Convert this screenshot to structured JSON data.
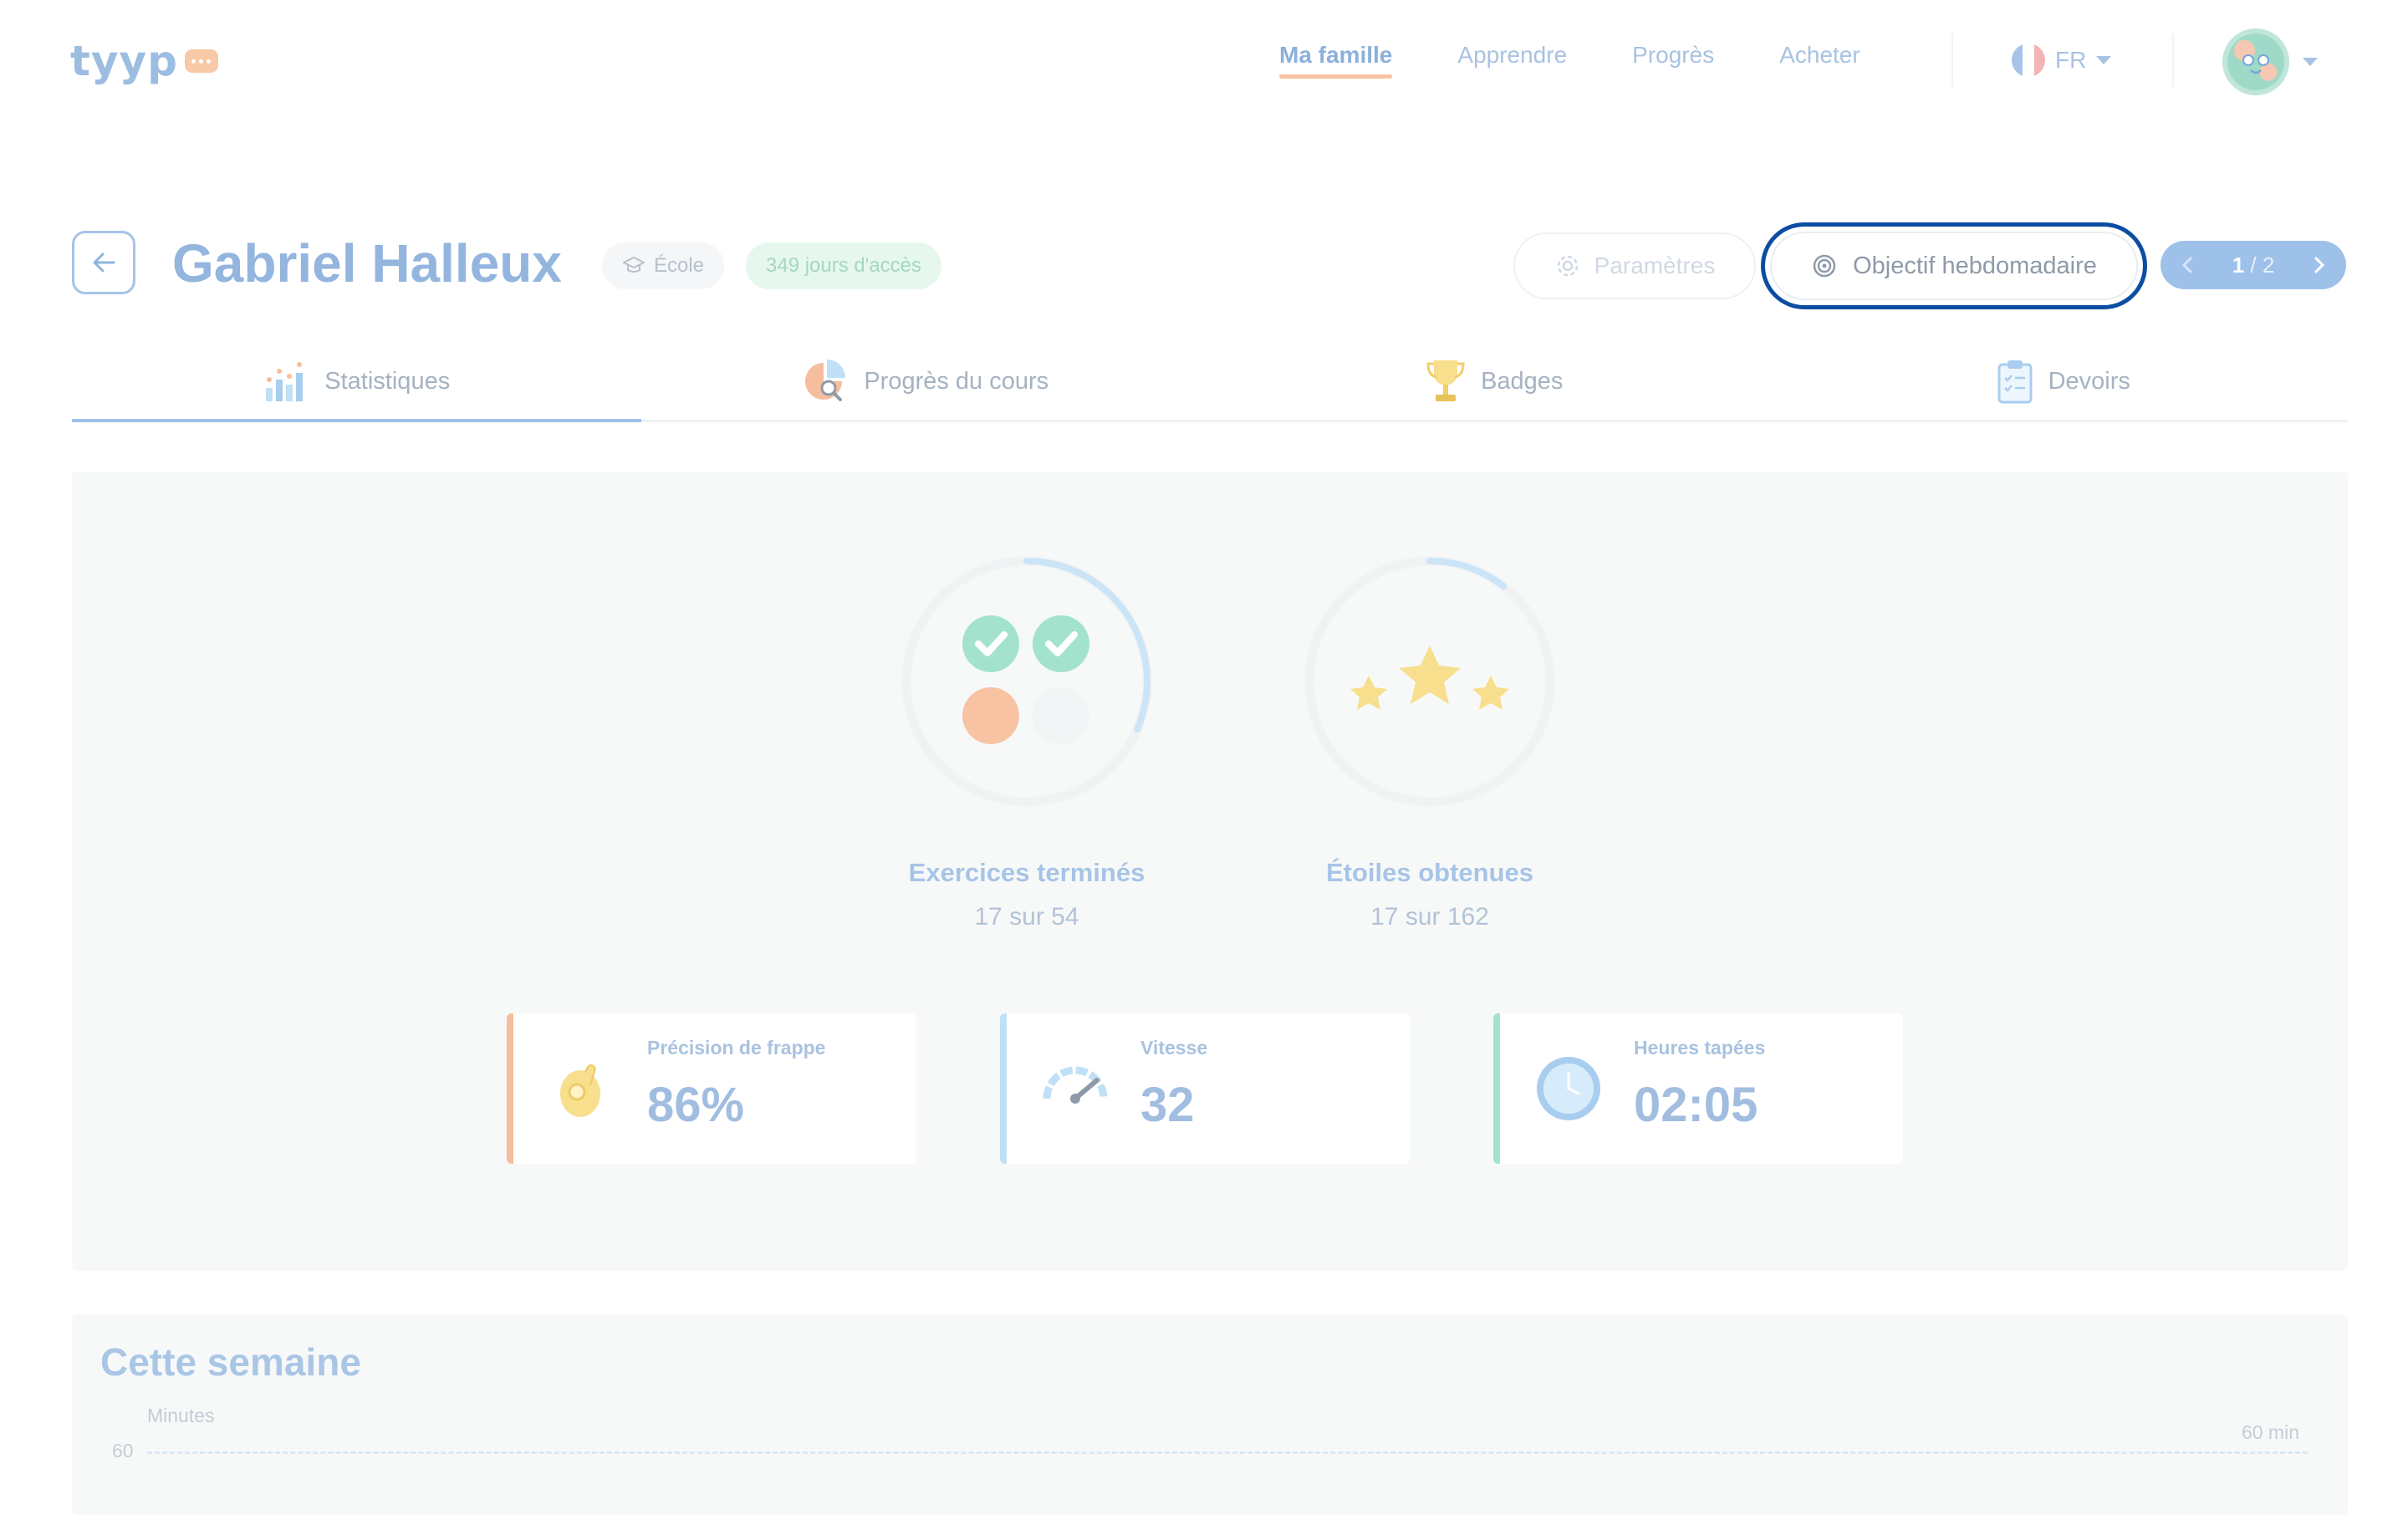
{
  "brand": {
    "logo_text": "tyyp"
  },
  "nav": {
    "links": [
      "Ma famille",
      "Apprendre",
      "Progrès",
      "Acheter"
    ],
    "active_index": 0,
    "language": "FR"
  },
  "student": {
    "name": "Gabriel Halleux",
    "school_badge": "École",
    "access_badge": "349 jours d'accès"
  },
  "actions": {
    "settings_label": "Paramètres",
    "goal_label": "Objectif hebdomadaire",
    "pager_current": "1",
    "pager_total": "/ 2"
  },
  "tabs": [
    "Statistiques",
    "Progrès du cours",
    "Badges",
    "Devoirs"
  ],
  "stats": {
    "exercises": {
      "title": "Exercices terminés",
      "sub": "17 sur 54",
      "progress": 0.315
    },
    "stars": {
      "title": "Étoiles obtenues",
      "sub": "17 sur 162",
      "progress": 0.105
    }
  },
  "metrics": [
    {
      "label": "Précision de frappe",
      "value": "86%",
      "color": "#f6bd9e",
      "icon": "ok-hand-icon"
    },
    {
      "label": "Vitesse",
      "value": "32",
      "color": "#bfe0f6",
      "icon": "speedometer-icon"
    },
    {
      "label": "Heures tapées",
      "value": "02:05",
      "color": "#a3e3cd",
      "icon": "clock-icon"
    }
  ],
  "week": {
    "title": "Cette semaine",
    "axis_title": "Minutes",
    "tick_top": "60",
    "goal_label": "60 min"
  },
  "colors": {
    "accent_blue": "#9ec1ea",
    "focus_ring": "#0b4da2",
    "nav_underline": "#f8c3a3"
  }
}
